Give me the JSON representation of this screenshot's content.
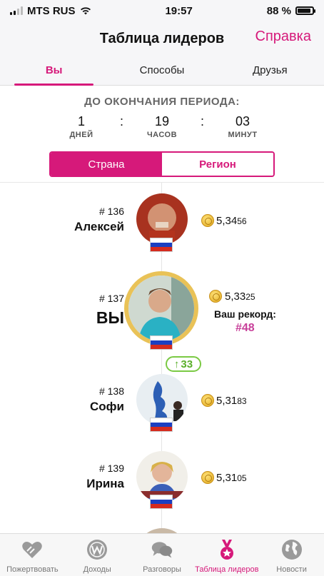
{
  "status_bar": {
    "carrier": "MTS RUS",
    "time": "19:57",
    "battery": "88 %",
    "battery_level": 0.88
  },
  "header": {
    "title": "Таблица лидеров",
    "help_link": "Справка"
  },
  "tabs": [
    {
      "label": "Вы",
      "active": true
    },
    {
      "label": "Способы",
      "active": false
    },
    {
      "label": "Друзья",
      "active": false
    }
  ],
  "countdown": {
    "title": "ДО ОКОНЧАНИЯ ПЕРИОДА:",
    "days": {
      "value": "1",
      "label": "ДНЕЙ"
    },
    "hours": {
      "value": "19",
      "label": "ЧАСОВ"
    },
    "minutes": {
      "value": "03",
      "label": "МИНУТ"
    },
    "separator": ":"
  },
  "scope_toggle": {
    "country": "Страна",
    "region": "Регион",
    "selected": "country"
  },
  "leaderboard": [
    {
      "rank": "# 136",
      "name": "Алексей",
      "score_main": "5,34",
      "score_small": "56"
    },
    {
      "rank": "# 137",
      "name": "ВЫ",
      "score_main": "5,33",
      "score_small": "25",
      "change": "33",
      "record_label": "Ваш рекорд:",
      "record_value": "#48"
    },
    {
      "rank": "# 138",
      "name": "Софи",
      "score_main": "5,31",
      "score_small": "83"
    },
    {
      "rank": "# 139",
      "name": "Ирина",
      "score_main": "5,31",
      "score_small": "05"
    }
  ],
  "tabbar": [
    {
      "label": "Пожертвовать",
      "icon": "heart-hands-icon",
      "active": false
    },
    {
      "label": "Доходы",
      "icon": "coin-w-icon",
      "active": false
    },
    {
      "label": "Разговоры",
      "icon": "chat-bubbles-icon",
      "active": false
    },
    {
      "label": "Таблица лидеров",
      "icon": "medal-icon",
      "active": true
    },
    {
      "label": "Новости",
      "icon": "globe-icon",
      "active": false
    }
  ],
  "colors": {
    "accent": "#d6197a",
    "green": "#7ac943",
    "record": "#c8409a",
    "gold": "#e9a92a"
  }
}
